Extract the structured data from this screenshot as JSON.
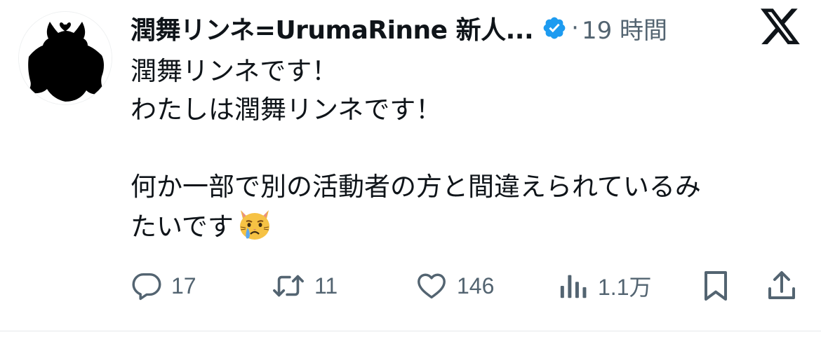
{
  "tweet": {
    "author": {
      "display_name": "潤舞リンネ=UrumaRinne 新人...",
      "verified": true,
      "avatar_icon": "silhouette-avatar"
    },
    "separator": "·",
    "timestamp": "19 時間",
    "platform_icon": "x-logo-icon",
    "body": {
      "line1": "潤舞リンネです！",
      "line2": "わたしは潤舞リンネです！",
      "line3": "何か一部で別の活動者の方と間違えられているみ",
      "line4": "たいです",
      "emoji": "crying-cat-face"
    },
    "actions": {
      "reply_count": "17",
      "retweet_count": "11",
      "like_count": "146",
      "views_count": "1.1万"
    }
  },
  "colors": {
    "text": "#0f1419",
    "muted": "#536471",
    "verified_blue": "#1d9bf0",
    "divider": "#e6e8ea"
  }
}
